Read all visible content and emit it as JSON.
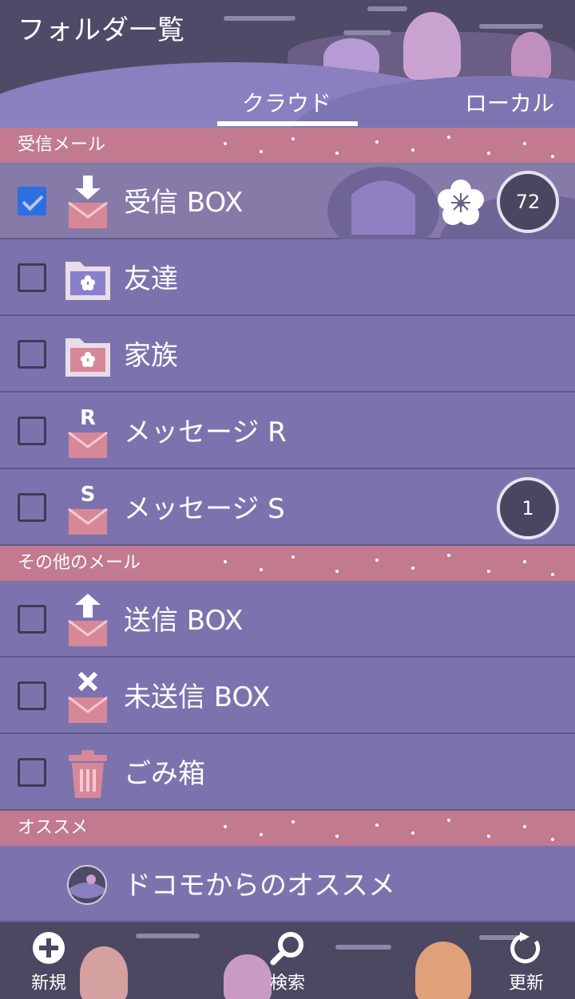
{
  "header": {
    "title": "フォルダ一覧",
    "tabs": [
      {
        "label": "クラウド",
        "active": true
      },
      {
        "label": "ローカル",
        "active": false
      }
    ]
  },
  "sections": [
    {
      "label": "受信メール"
    },
    {
      "label": "その他のメール"
    },
    {
      "label": "オススメ"
    }
  ],
  "folders": [
    {
      "label": "受信 BOX",
      "checked": true,
      "icon": "inbox-download-icon",
      "count": "72",
      "badge_icon": "plum-flower-icon"
    },
    {
      "label": "友達",
      "checked": false,
      "icon": "folder-flower-icon"
    },
    {
      "label": "家族",
      "checked": false,
      "icon": "folder-flower-icon"
    },
    {
      "label": "メッセージ R",
      "checked": false,
      "icon": "mail-r-icon",
      "icon_letter": "R"
    },
    {
      "label": "メッセージ S",
      "checked": false,
      "icon": "mail-s-icon",
      "icon_letter": "S",
      "count": "1"
    },
    {
      "label": "送信 BOX",
      "checked": false,
      "icon": "outbox-upload-icon"
    },
    {
      "label": "未送信 BOX",
      "checked": false,
      "icon": "mail-x-icon"
    },
    {
      "label": "ごみ箱",
      "checked": false,
      "icon": "trash-icon"
    },
    {
      "label": "ドコモからのオススメ",
      "icon": "docomo-recommend-icon"
    }
  ],
  "bottom_bar": [
    {
      "label": "新規",
      "icon": "plus-circle-icon"
    },
    {
      "label": "検索",
      "icon": "search-icon"
    },
    {
      "label": "更新",
      "icon": "refresh-icon"
    }
  ],
  "colors": {
    "header_bg": "#4e4a68",
    "list_bg": "#7c73ae",
    "section_bg": "#c27a8e",
    "mail_icon": "#d78898",
    "checkbox_checked": "#2c6fe0",
    "badge_bg": "#4a4560"
  }
}
